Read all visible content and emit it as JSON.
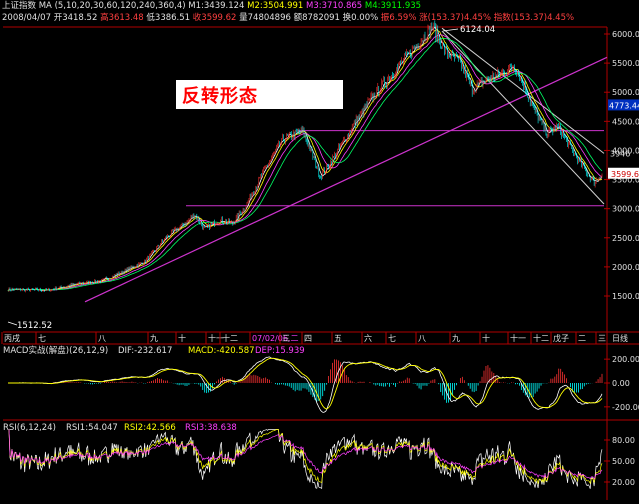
{
  "header": {
    "index_name": "上证指数",
    "ma_params": "MA (5,10,20,30,60,120,240,360,4)",
    "m1": "M1:3439.124",
    "m2": "M2:3504.991",
    "m3": "M3:3710.865",
    "m4": "M4:3911.935",
    "date": "2008/04/07",
    "open": "开3418.52",
    "high": "高3613.48",
    "low": "低3386.51",
    "close": "收3599.62",
    "volume": "量74804896",
    "amount": "额8782091",
    "turnover": "换0.00%",
    "amplitude": "振6.59%",
    "change": "涨(153.37)4.45%",
    "index_change": "指数(153.37)4.45%"
  },
  "title": "反转形态",
  "colors": {
    "background": "#000000",
    "up": "#ff3333",
    "down": "#00ffff",
    "trendline": "#cc33cc",
    "axis": "#b00000",
    "ma_white": "#ffffff",
    "ma_yellow": "#ffff00",
    "ma_magenta": "#ff40ff",
    "ma_green": "#00ff66"
  },
  "main_chart": {
    "high_label": "6124.04",
    "low_label": "1512.52",
    "price_ticks": [
      "6000.00",
      "5500.00",
      "5000.00",
      "4500.00",
      "4000.00",
      "3500.00",
      "3000.00",
      "2500.00",
      "2000.00",
      "1500.00"
    ],
    "price_tick_values": [
      6000,
      5500,
      5000,
      4500,
      4000,
      3500,
      3000,
      2500,
      2000,
      1500
    ],
    "current_price": "3599.6",
    "current_value": 3599.6,
    "marker_price": "4773.44",
    "marker_value": 4773.44,
    "marker_top": "3946",
    "marker_top_value": 3946,
    "support_levels": [
      3050,
      4340
    ],
    "month_labels": [
      "丙戌",
      "七",
      "八",
      "九",
      "十",
      "十一",
      "十二",
      "07/02/06,二",
      "三",
      "四",
      "五",
      "六",
      "七",
      "八",
      "九",
      "十",
      "十一",
      "十二",
      "戊子",
      "二",
      "三"
    ],
    "date_tag": "日线"
  },
  "chart_data": [
    {
      "type": "candlestick",
      "title": "",
      "xlabel": "",
      "ylabel": "",
      "ylim": [
        1400,
        6250
      ],
      "grid": false,
      "x_period": "2006-07 to 2008-04",
      "series": [
        {
          "name": "",
          "note_key_points": [
            [
              "2006-07",
              1612
            ],
            [
              "2006-10",
              1750
            ],
            [
              "2007-01",
              2700
            ],
            [
              "2007-02",
              2800
            ],
            [
              "2007-05",
              4300
            ],
            [
              "2007-06",
              3700
            ],
            [
              "2007-08",
              5100
            ],
            [
              "2007-10",
              6124.04
            ],
            [
              "2007-11",
              5000
            ],
            [
              "2007-12",
              5400
            ],
            [
              "2008-01",
              4400
            ],
            [
              "2008-04",
              3599.62
            ]
          ]
        }
      ]
    },
    {
      "type": "bar",
      "title": "MACD实战(解盘)(26,12,9)",
      "dif": "DIF:-232.617",
      "macd": "MACD:-420.587",
      "dep": "DEP:15.939",
      "y_ticks": [
        "200.00",
        "0.00",
        "-200.00"
      ],
      "y_tick_values": [
        200,
        0,
        -200
      ],
      "ylim": [
        -260,
        260
      ]
    },
    {
      "type": "line",
      "title": "RSI(6,12,24)",
      "series": [
        {
          "name": "RSI1:54.047"
        },
        {
          "name": "RSI2:42.566"
        },
        {
          "name": "RSI3:38.638"
        }
      ],
      "y_ticks": [
        "80.00",
        "50.00",
        "20.00"
      ],
      "y_tick_values": [
        80,
        50,
        20
      ],
      "ylim": [
        0,
        100
      ]
    }
  ]
}
